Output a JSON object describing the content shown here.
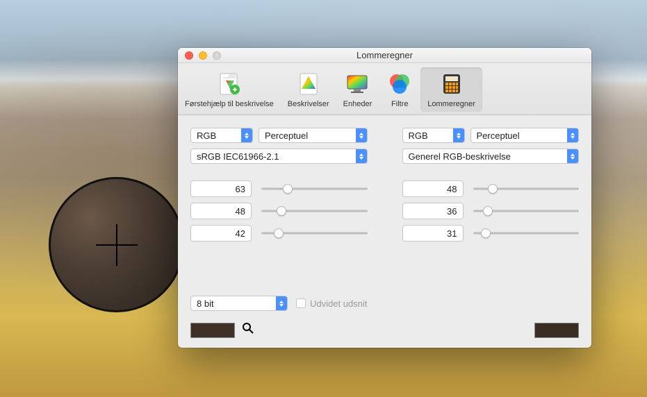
{
  "window": {
    "title": "Lommeregner"
  },
  "toolbar": {
    "items": [
      {
        "label": "Førstehjælp til beskrivelse"
      },
      {
        "label": "Beskrivelser"
      },
      {
        "label": "Enheder"
      },
      {
        "label": "Filtre"
      },
      {
        "label": "Lommeregner"
      }
    ],
    "selected_index": 4
  },
  "left": {
    "model": "RGB",
    "intent": "Perceptuel",
    "profile": "sRGB IEC61966-2.1",
    "channels": [
      {
        "value": "63",
        "pct": 24.7
      },
      {
        "value": "48",
        "pct": 18.8
      },
      {
        "value": "42",
        "pct": 16.5
      }
    ]
  },
  "right": {
    "model": "RGB",
    "intent": "Perceptuel",
    "profile": "Generel RGB-beskrivelse",
    "channels": [
      {
        "value": "48",
        "pct": 18.8
      },
      {
        "value": "36",
        "pct": 14.1
      },
      {
        "value": "31",
        "pct": 12.2
      }
    ]
  },
  "bit_depth": "8 bit",
  "gamut_checkbox_label": "Udvidet udsnit",
  "swatch_left": "#3f3027",
  "swatch_right": "#3a2d24"
}
